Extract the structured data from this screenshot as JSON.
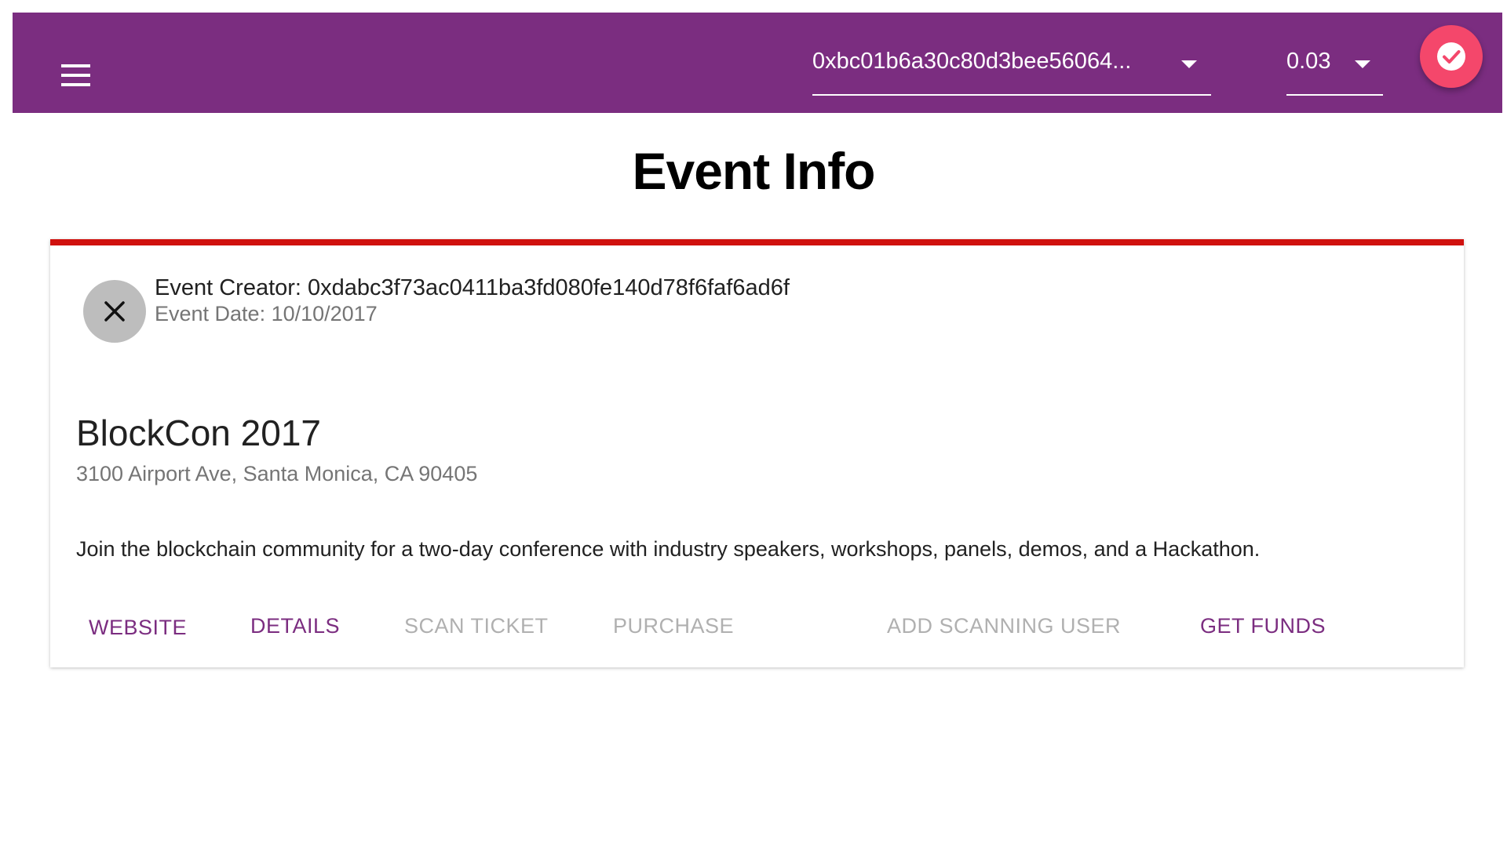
{
  "app_bar": {
    "color": "#7b2d80",
    "menu_icon": "hamburger-menu-icon",
    "account": {
      "value": "0xbc01b6a30c80d3bee56064...",
      "caret_icon": "dropdown-caret-icon"
    },
    "gas_price": {
      "value": "0.03",
      "caret_icon": "dropdown-caret-icon"
    },
    "fab": {
      "icon": "check-circle-icon",
      "color": "#f4476b"
    }
  },
  "page": {
    "title": "Event Info"
  },
  "event_card": {
    "accent_color": "#d0110e",
    "avatar_icon": "close-icon",
    "creator": "Event Creator: 0xdabc3f73ac0411ba3fd080fe140d78f6faf6ad6f",
    "date": "Event Date: 10/10/2017",
    "name": "BlockCon 2017",
    "address": "3100 Airport Ave, Santa Monica, CA 90405",
    "description": "Join the blockchain community for a two-day conference with industry speakers, workshops, panels, demos, and a Hackathon.",
    "actions": {
      "website": "WEBSITE",
      "details": "DETAILS",
      "scan_ticket": "SCAN TICKET",
      "purchase": "PURCHASE",
      "add_scanning_user": "ADD SCANNING USER",
      "get_funds": "GET FUNDS"
    }
  }
}
